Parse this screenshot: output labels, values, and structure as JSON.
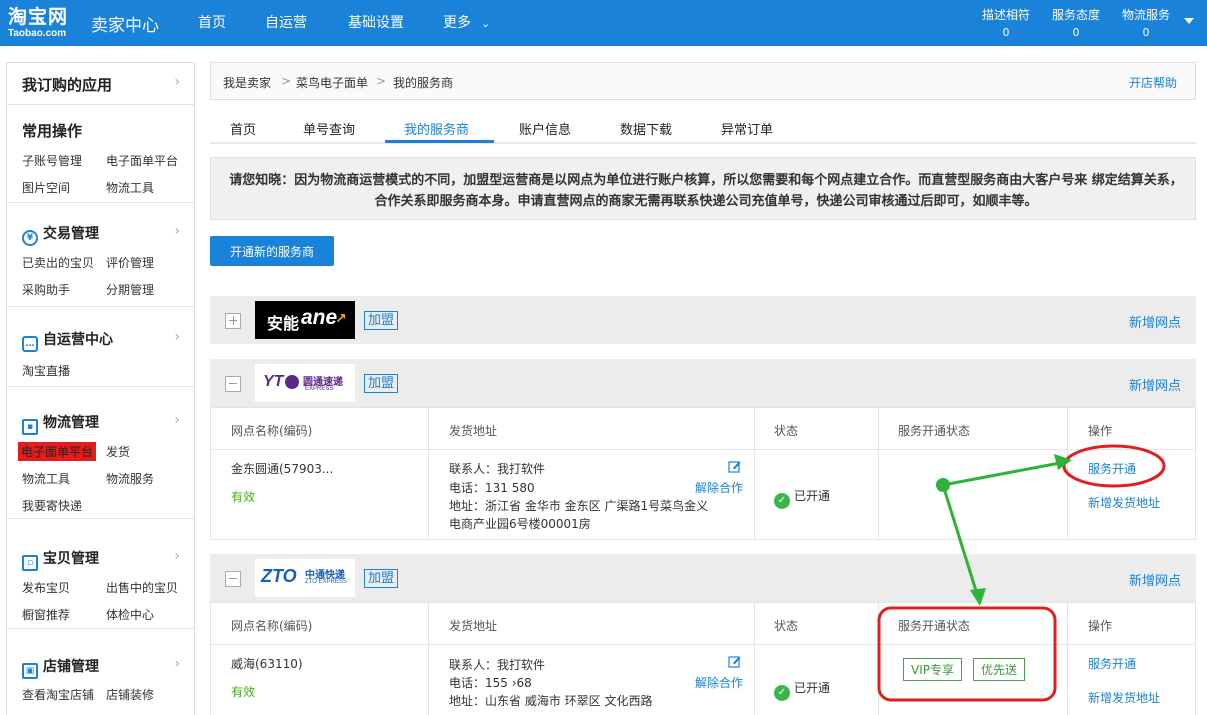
{
  "header": {
    "logo_cn": "淘宝网",
    "logo_en": "Taobao.com",
    "title": "卖家中心",
    "nav": [
      "首页",
      "自运营",
      "基础设置",
      "更多"
    ],
    "stats": [
      {
        "label": "描述相符",
        "value": "0"
      },
      {
        "label": "服务态度",
        "value": "0"
      },
      {
        "label": "物流服务",
        "value": "0"
      }
    ]
  },
  "sidebar": {
    "subscribed": "我订购的应用",
    "common": {
      "title": "常用操作",
      "items": [
        "子账号管理",
        "电子面单平台",
        "图片空间",
        "物流工具"
      ]
    },
    "trade": {
      "title": "交易管理",
      "items": [
        "已卖出的宝贝",
        "评价管理",
        "采购助手",
        "分期管理"
      ]
    },
    "selfop": {
      "title": "自运营中心",
      "items": [
        "淘宝直播"
      ]
    },
    "logistics": {
      "title": "物流管理",
      "items": [
        "电子面单平台",
        "发货",
        "物流工具",
        "物流服务",
        "我要寄快递"
      ]
    },
    "goods": {
      "title": "宝贝管理",
      "items": [
        "发布宝贝",
        "出售中的宝贝",
        "橱窗推荐",
        "体检中心"
      ]
    },
    "shop": {
      "title": "店铺管理",
      "items": [
        "查看淘宝店铺",
        "店铺装修"
      ]
    }
  },
  "breadcrumb": {
    "items": [
      "我是卖家",
      "菜鸟电子面单",
      "我的服务商"
    ],
    "help": "开店帮助"
  },
  "tabs": [
    "首页",
    "单号查询",
    "我的服务商",
    "账户信息",
    "数据下载",
    "异常订单"
  ],
  "notice": "请您知晓：因为物流商运营模式的不同，加盟型运营商是以网点为单位进行账户核算，所以您需要和每个网点建立合作。而直营型服务商由大客户号来 绑定结算关系，合作关系即服务商本身。申请直营网点的商家无需再联系快递公司充值单号，快递公司审核通过后即可，如顺丰等。",
  "open_button": "开通新的服务商",
  "providers": [
    {
      "logo_text": "安能",
      "logo_en": "ane",
      "type": "加盟",
      "add": "新增网点"
    },
    {
      "logo_text": "圆通速递",
      "logo_en": "YT",
      "logo_sub": "EXPRESS",
      "type": "加盟",
      "add": "新增网点"
    },
    {
      "logo_text": "中通快递",
      "logo_en": "ZTO",
      "logo_sub": "ZTO EXPRESS",
      "type": "加盟",
      "add": "新增网点"
    }
  ],
  "columns": [
    "网点名称(编码)",
    "发货地址",
    "状态",
    "服务开通状态",
    "操作"
  ],
  "rows": [
    {
      "name": "金东圆通(57903...",
      "valid": "有效",
      "contact": "联系人：我打软件",
      "phone": "电话：131         580",
      "addr1": "地址：浙江省 金华市 金东区 广渠路1号菜鸟金义",
      "addr2": "电商产业园6号楼00001房",
      "unbind": "解除合作",
      "status": "已开通",
      "ops": [
        "服务开通",
        "新增发货地址"
      ]
    },
    {
      "name": "威海(63110)",
      "valid": "有效",
      "contact": "联系人：我打软件",
      "phone": "电话：155          ›68",
      "addr1": "地址：山东省 威海市 环翠区 文化西路",
      "unbind": "解除合作",
      "status": "已开通",
      "tags": [
        "VIP专享",
        "优先送"
      ],
      "ops": [
        "服务开通",
        "新增发货地址"
      ]
    }
  ],
  "colors": {
    "brand": "#1a82d9",
    "annotation_red": "#e02020",
    "annotation_green": "#2db33a"
  }
}
